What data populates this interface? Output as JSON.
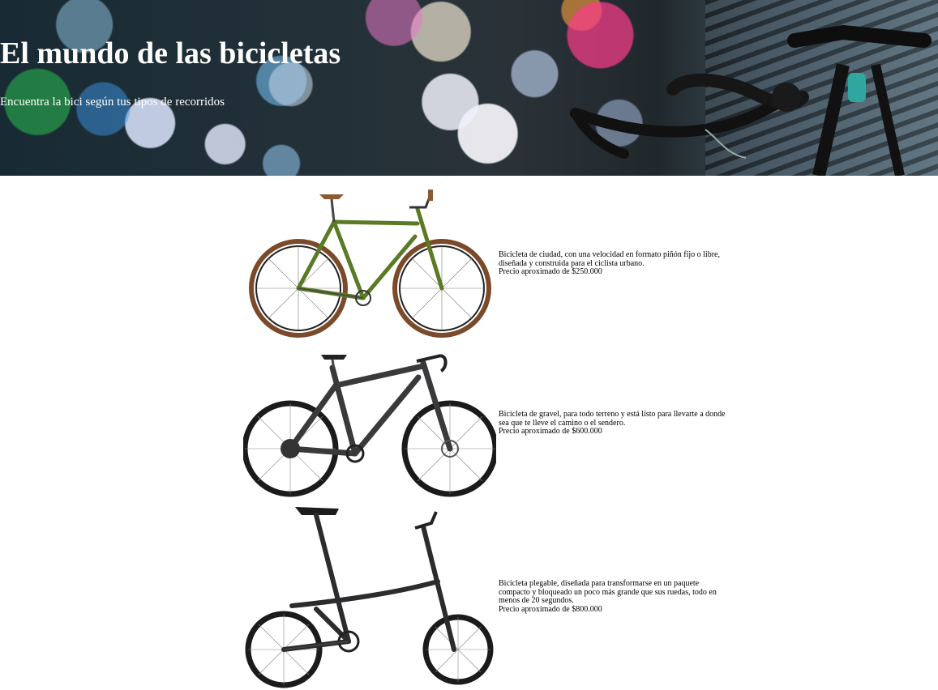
{
  "header": {
    "title": "El mundo de las bicicletas",
    "subtitle": "Encuentra la bici según tus tipos de recorridos"
  },
  "products": [
    {
      "image_icon": "city-fixie-bicycle-icon",
      "frame_color": "#5a7a26",
      "description": "Bicicleta de ciudad, con una velocidad en formato piñón fijo o libre, diseñada y construida para el ciclista urbano.",
      "price": "Precio aproximado de $250.000"
    },
    {
      "image_icon": "gravel-bicycle-icon",
      "frame_color": "#3a3a3c",
      "description": "Bicicleta de gravel, para todo terreno y está listo para llevarte a donde sea que te lleve el camino o el sendero.",
      "price": "Precio aproximado de $600.000"
    },
    {
      "image_icon": "folding-bicycle-icon",
      "frame_color": "#2c2c2e",
      "description": "Bicicleta plegable, diseñada para transformarse en un paquete compacto y bloqueado un poco más grande que sus ruedas, todo en menos de 20 segundos.",
      "price": "Precio aproximado de $800.000"
    }
  ]
}
